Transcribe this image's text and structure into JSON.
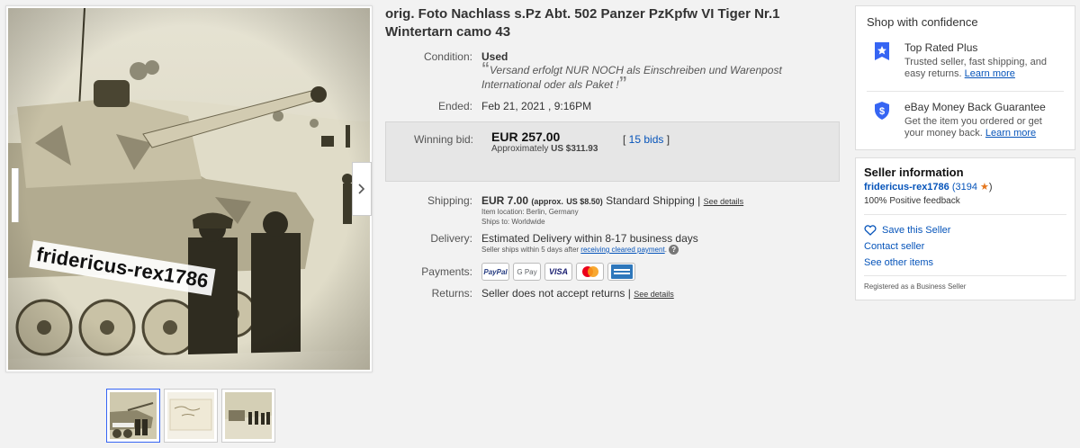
{
  "listing": {
    "title": "orig. Foto Nachlass s.Pz Abt. 502 Panzer PzKpfw VI Tiger Nr.1 Wintertarn camo 43"
  },
  "gallery": {
    "watermark": "fridericus-rex1786",
    "thumbnail_count": 3
  },
  "details": {
    "condition_label": "Condition:",
    "condition_value": "Used",
    "condition_note": "Versand erfolgt NUR NOCH als Einschreiben und Warenpost International oder als Paket !",
    "ended_label": "Ended:",
    "ended_value": "Feb 21, 2021 , 9:16PM",
    "winning_bid_label": "Winning bid:",
    "winning_bid_value": "EUR 257.00",
    "approx_label": "Approximately",
    "approx_value": "US $311.93",
    "bids": "15 bids",
    "shipping_label": "Shipping:",
    "shipping_value": "EUR 7.00",
    "shipping_approx_prefix": "(approx.",
    "shipping_approx_value": "US $8.50)",
    "shipping_method": "Standard Shipping |",
    "see_details": "See details",
    "item_location": "Item location:  Berlin, Germany",
    "ships_to": "Ships to:  Worldwide",
    "delivery_label": "Delivery:",
    "delivery_value": "Estimated Delivery within 8-17 business days",
    "delivery_note_prefix": "Seller ships within 5 days after",
    "delivery_note_link": "receiving cleared payment",
    "payments_label": "Payments:",
    "payment_methods": [
      "PayPal",
      "G Pay",
      "VISA",
      "Mastercard",
      "American Express"
    ],
    "returns_label": "Returns:",
    "returns_value": "Seller does not accept returns |",
    "returns_see_details": "See details"
  },
  "confidence": {
    "heading": "Shop with confidence",
    "top_rated_title": "Top Rated Plus",
    "top_rated_desc": "Trusted seller, fast shipping, and easy returns.",
    "learn_more": "Learn more",
    "mbg_title": "eBay Money Back Guarantee",
    "mbg_desc": "Get the item you ordered or get your money back.",
    "mbg_learn_more": "Learn more"
  },
  "seller": {
    "heading": "Seller information",
    "name": "fridericus-rex1786",
    "score": "(3194",
    "score_close": ")",
    "feedback": "100% Positive feedback",
    "save": "Save this Seller",
    "contact": "Contact seller",
    "other_items": "See other items",
    "registered": "Registered as a Business Seller"
  },
  "colors": {
    "link": "#0654ba",
    "star": "#e5761c",
    "bid_box": "#e6e6e6"
  }
}
